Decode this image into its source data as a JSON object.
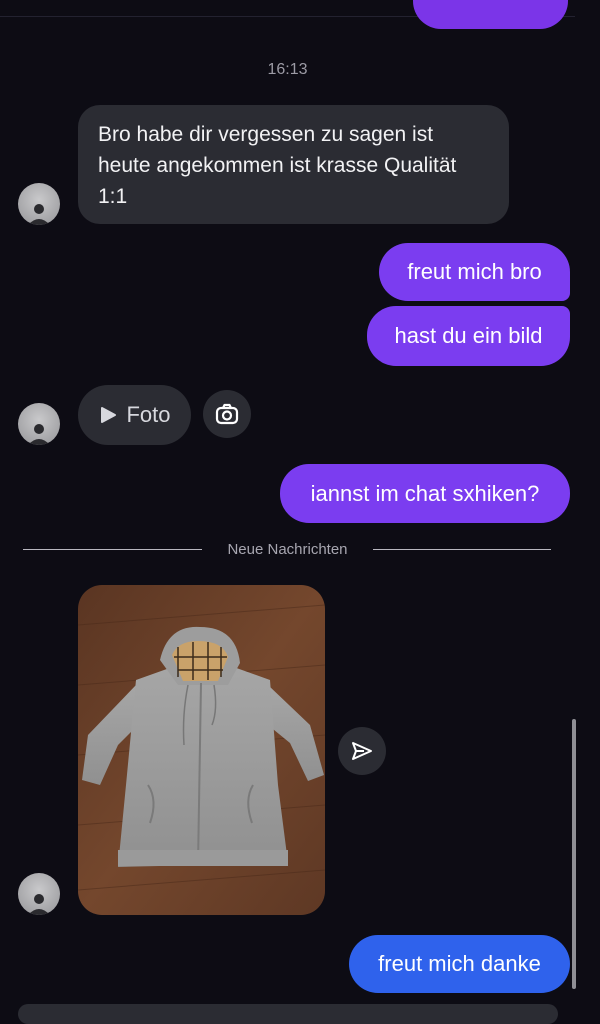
{
  "chat": {
    "timestamp": "16:13",
    "incoming_message_1": "Bro habe dir vergessen zu sagen ist heute angekommen ist krasse Qualität 1:1",
    "outgoing_message_1": "freut mich bro",
    "outgoing_message_2": "hast du ein bild",
    "foto_label": "Foto",
    "outgoing_message_3": "iannst im chat sxhiken?",
    "new_messages_label": "Neue Nachrichten",
    "outgoing_message_4": "freut mich danke"
  },
  "colors": {
    "background": "#0d0c14",
    "incoming_bubble": "#2b2c33",
    "outgoing_purple": "#7b3df0",
    "outgoing_blue": "#2f62ec"
  },
  "icons": [
    "avatar-placeholder-icon",
    "play-icon",
    "camera-icon",
    "send-share-icon"
  ]
}
